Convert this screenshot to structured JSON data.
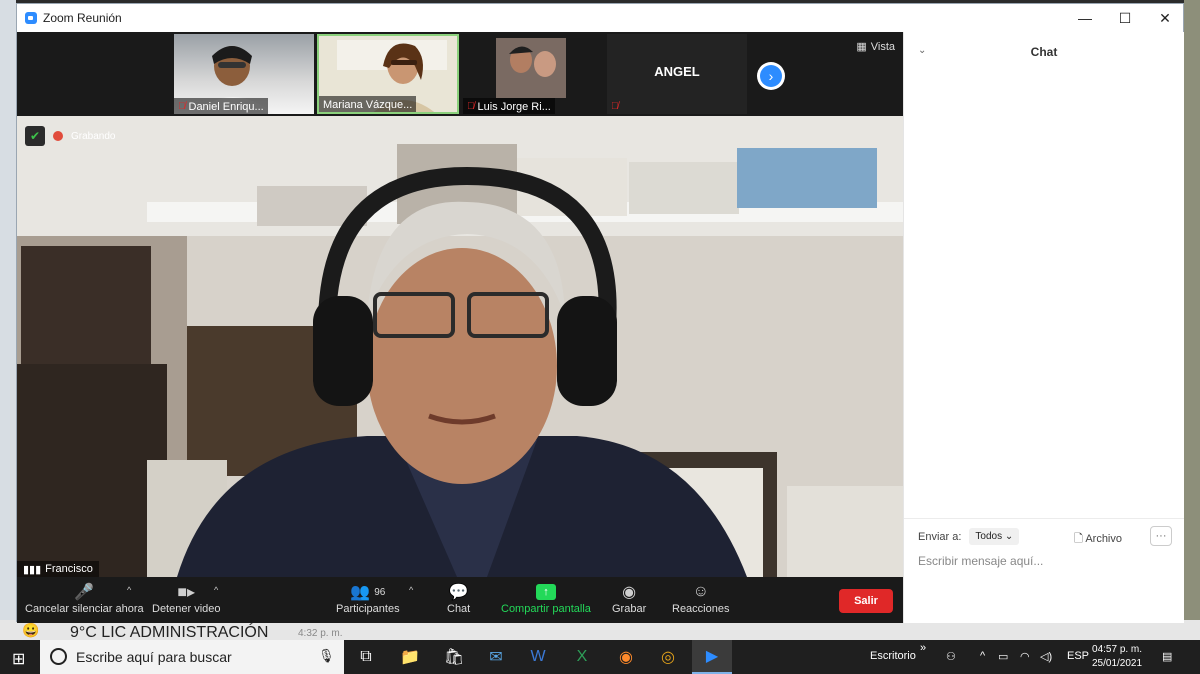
{
  "window": {
    "title": "Zoom Reunión",
    "minimize": "—",
    "maximize": "☐",
    "close": "✕"
  },
  "strip": {
    "thumbs": [
      {
        "name": "Daniel Enriqu...",
        "muted": true
      },
      {
        "name": "Mariana Vázque...",
        "muted": false
      },
      {
        "name": "Luis Jorge Ri...",
        "muted": true
      },
      {
        "name": "",
        "muted": true
      }
    ],
    "text_tile": "ANGEL",
    "vista": "Vista",
    "next_icon": "chevron-right-icon"
  },
  "main_video": {
    "recording": "Grabando",
    "speaker": "Francisco"
  },
  "toolbar": {
    "unmute": "Cancelar silenciar ahora",
    "stop_video": "Detener video",
    "participants": "Participantes",
    "participants_count": "96",
    "chat": "Chat",
    "share": "Compartir pantalla",
    "record": "Grabar",
    "reactions": "Reacciones",
    "leave": "Salir"
  },
  "chat": {
    "title": "Chat",
    "send_to_label": "Enviar a:",
    "send_to_value": "Todos",
    "file": "Archivo",
    "more": "···",
    "placeholder": "Escribir mensaje aquí..."
  },
  "background_notification": {
    "text": "9°C LIC ADMINISTRACIÓN",
    "time": "4:32 p. m."
  },
  "taskbar": {
    "search_placeholder": "Escribe aquí para buscar",
    "desktop": "Escritorio",
    "lang": "ESP",
    "time": "04:57 p. m.",
    "date": "25/01/2021"
  },
  "colors": {
    "accent": "#2d8cff",
    "leave": "#e02828",
    "share": "#23d959",
    "muted": "#e02828"
  }
}
